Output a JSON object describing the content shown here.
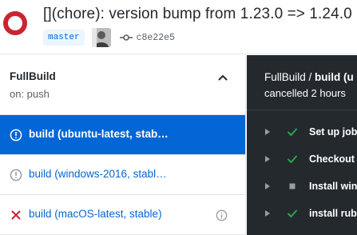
{
  "header": {
    "title": "[](chore): version bump from 1.23.0 => 1.24.0",
    "branch": "master",
    "commit_sha": "c8e22e5",
    "status_icon": "failure-ring-icon",
    "colors": {
      "failure": "#cb2431",
      "link": "#0366d6"
    }
  },
  "sidebar": {
    "workflow_name": "FullBuild",
    "workflow_trigger": "on: push",
    "jobs": [
      {
        "label": "build (ubuntu-latest, stab…",
        "status": "cancelled",
        "icon": "cancelled-icon",
        "selected": true
      },
      {
        "label": "build (windows-2016, stabl…",
        "status": "cancelled",
        "icon": "cancelled-icon",
        "selected": false
      },
      {
        "label": "build (macOS-latest, stable)",
        "status": "failure",
        "icon": "x-icon",
        "selected": false
      }
    ]
  },
  "log": {
    "breadcrumb_workflow": "FullBuild / ",
    "breadcrumb_job": "build (u",
    "status_text": "cancelled 2 hours",
    "steps": [
      {
        "label": "Set up job",
        "status": "success"
      },
      {
        "label": "Checkout",
        "status": "success"
      },
      {
        "label": "Install win",
        "status": "skipped"
      },
      {
        "label": "install ruby",
        "status": "success"
      }
    ],
    "colors": {
      "background": "#24292e",
      "success": "#28a745"
    }
  }
}
